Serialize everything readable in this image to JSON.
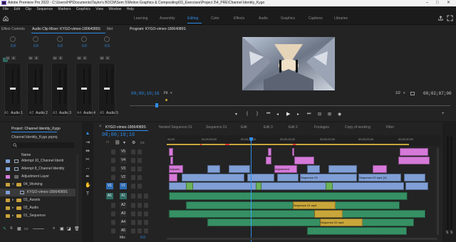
{
  "titlebar": {
    "title": "Adobe Premiere Pro 2022 - C:\\Users\\HP\\Documents\\Taylor's BOCM\\Sem 5\\Motion Graphics & Compositing\\03_Exercises\\Project 3\\4_PRE\\Channel Identity_Kygo"
  },
  "menu": [
    "File",
    "Edit",
    "Clip",
    "Sequence",
    "Markers",
    "Graphics",
    "View",
    "Window",
    "Help"
  ],
  "workspaces": [
    {
      "label": "Learning",
      "active": false
    },
    {
      "label": "Assembly",
      "active": false
    },
    {
      "label": "Editing",
      "active": true
    },
    {
      "label": "Color",
      "active": false
    },
    {
      "label": "Effects",
      "active": false
    },
    {
      "label": "Audio",
      "active": false
    },
    {
      "label": "Graphics",
      "active": false
    },
    {
      "label": "Captions",
      "active": false
    },
    {
      "label": "Libraries",
      "active": false
    }
  ],
  "mixer": {
    "left_tab": "Effect Controls",
    "title": "Audio Clip Mixer: KYGO-vimeo-18064089S",
    "right_tab": "Met",
    "channels": [
      {
        "a": "A1",
        "name": "Audio 1",
        "value": "0.0"
      },
      {
        "a": "A2",
        "name": "Audio 2",
        "value": "0.0"
      },
      {
        "a": "A3",
        "name": "Audio 3",
        "value": "0.0"
      },
      {
        "a": "A4",
        "name": "Audio 4",
        "value": "0.0"
      },
      {
        "a": "A5",
        "name": "Audio 5",
        "value": "0.0"
      }
    ]
  },
  "program": {
    "title": "Program: KYGO-vimeo-18064089S",
    "timecode": "00;00;10;16",
    "fit": "Fit",
    "quality": "1/2",
    "duration": "00;02;07;00"
  },
  "project": {
    "tab": "Project: Channel Identity_Kygo",
    "file": "Channel Identity_Kygo.prproj",
    "header": "Name",
    "items": [
      {
        "label": "Attempt 10_Channel Identi",
        "color": "#7f9fd6",
        "kind": "sequence",
        "level": 0
      },
      {
        "label": "Attempt 8_Channel Identity",
        "color": "#7f9fd6",
        "kind": "sequence",
        "level": 0
      },
      {
        "label": "Adjustment Layer",
        "color": "#d57ad8",
        "kind": "item",
        "level": 0
      },
      {
        "label": "04_Working",
        "color": "#c9a23a",
        "kind": "folder-open",
        "level": 0
      },
      {
        "label": "KYGO-vimeo-18064089S",
        "color": "#7f9fd6",
        "kind": "sequence",
        "level": 1
      },
      {
        "label": "03_Assets",
        "color": "#c9a23a",
        "kind": "folder",
        "level": 0
      },
      {
        "label": "02_Audio",
        "color": "#c9a23a",
        "kind": "folder",
        "level": 0
      },
      {
        "label": "01_Sequence",
        "color": "#c9a23a",
        "kind": "folder",
        "level": 0
      }
    ]
  },
  "timeline": {
    "tabs": [
      {
        "label": "KYGO-vimeo-18064089S",
        "active": true
      },
      {
        "label": "Nested Sequence 01",
        "active": false
      },
      {
        "label": "Sequence 01",
        "active": false
      },
      {
        "label": "Edit",
        "active": false
      },
      {
        "label": "Edit 3",
        "active": false
      },
      {
        "label": "Edit 2",
        "active": false
      },
      {
        "label": "Footages",
        "active": false
      },
      {
        "label": "Copy of working",
        "active": false
      },
      {
        "label": "Filter",
        "active": false
      }
    ],
    "timecode": "00;00;10;16",
    "ruler": [
      "00;00",
      "00;00;05;00",
      "00;00;10;00",
      "00;00;15;00",
      "00;00;20;00",
      "00;00;25;00",
      "00;00;30;00"
    ],
    "video_tracks": [
      "V5",
      "V4",
      "V3",
      "V2",
      "V1"
    ],
    "audio_tracks": [
      "A1",
      "A2",
      "A3",
      "A4",
      "A5"
    ],
    "mix_label": "Mix",
    "mix_value": "0.0",
    "clip_labels": [
      "Adjustm",
      "Adjustment",
      "Sequence 03",
      "Sequence 02.mp4 [V]",
      "Sequence 01.mp4",
      "Sequence 02.mp4"
    ],
    "meter_labels": [
      "S",
      "S"
    ]
  }
}
